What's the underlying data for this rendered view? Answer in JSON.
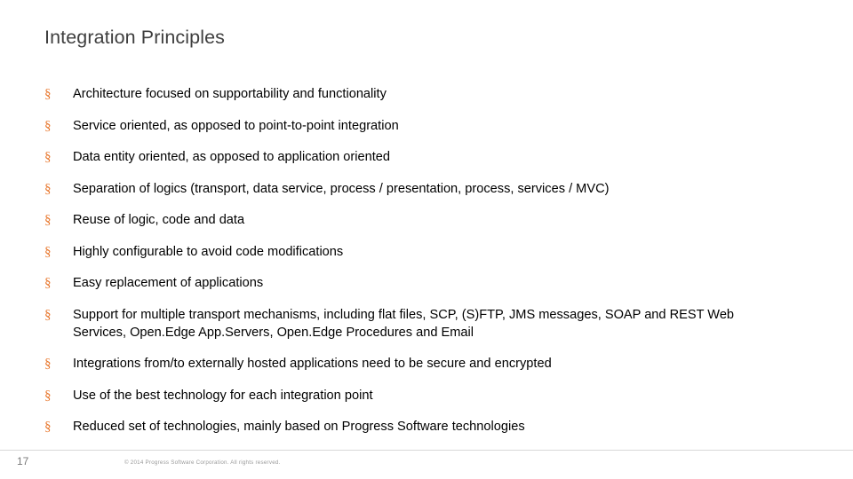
{
  "slide": {
    "title": "Integration Principles",
    "bullet_marker": "§",
    "bullets": [
      "Architecture focused on supportability and functionality",
      "Service oriented, as opposed to point-to-point integration",
      "Data entity oriented, as opposed to application oriented",
      "Separation of logics (transport, data service, process / presentation, process, services / MVC)",
      "Reuse of logic, code and data",
      "Highly configurable to avoid code modifications",
      "Easy replacement of applications",
      "Support for multiple transport mechanisms, including flat files, SCP, (S)FTP, JMS messages, SOAP and REST Web Services, Open.Edge App.Servers, Open.Edge Procedures and Email",
      "Integrations from/to externally hosted applications need to be secure and encrypted",
      "Use of the best technology for each integration point",
      "Reduced set of technologies, mainly based on Progress Software technologies"
    ],
    "slide_number": "17",
    "copyright": "© 2014 Progress Software Corporation. All rights reserved.",
    "accent_color": "#e8762c",
    "title_color": "#3f3f3f"
  }
}
